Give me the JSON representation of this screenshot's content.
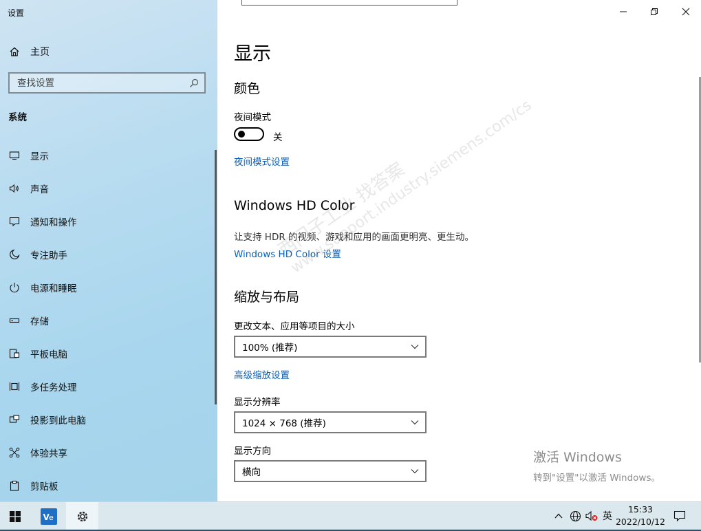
{
  "app": {
    "title": "设置"
  },
  "sidebar": {
    "home_label": "主页",
    "search_placeholder": "查找设置",
    "section_label": "系统",
    "items": [
      {
        "label": "显示",
        "icon": "monitor-icon"
      },
      {
        "label": "声音",
        "icon": "speaker-icon"
      },
      {
        "label": "通知和操作",
        "icon": "notification-icon"
      },
      {
        "label": "专注助手",
        "icon": "moon-icon"
      },
      {
        "label": "电源和睡眠",
        "icon": "power-icon"
      },
      {
        "label": "存储",
        "icon": "storage-icon"
      },
      {
        "label": "平板电脑",
        "icon": "tablet-icon"
      },
      {
        "label": "多任务处理",
        "icon": "multitask-icon"
      },
      {
        "label": "投影到此电脑",
        "icon": "project-icon"
      },
      {
        "label": "体验共享",
        "icon": "share-icon"
      },
      {
        "label": "剪贴板",
        "icon": "clipboard-icon"
      }
    ]
  },
  "main": {
    "title": "显示",
    "color_section": {
      "heading": "颜色",
      "night_mode_label": "夜间模式",
      "night_mode_state": "关",
      "night_mode_on": false,
      "night_mode_link": "夜间模式设置"
    },
    "hdr_section": {
      "heading": "Windows HD Color",
      "description": "让支持 HDR 的视频、游戏和应用的画面更明亮、更生动。",
      "link": "Windows HD Color 设置"
    },
    "scale_section": {
      "heading": "缩放与布局",
      "scale_label": "更改文本、应用等项目的大小",
      "scale_value": "100% (推荐)",
      "advanced_link": "高级缩放设置",
      "resolution_label": "显示分辨率",
      "resolution_value": "1024 × 768 (推荐)",
      "orientation_label": "显示方向",
      "orientation_value": "横向"
    },
    "watermark": {
      "line1": "西门子工业 找答案",
      "line2": "www.support.industry.siemens.com/cs"
    },
    "activation": {
      "title": "激活 Windows",
      "subtitle": "转到\"设置\"以激活 Windows。"
    }
  },
  "taskbar": {
    "input_method": "英",
    "time": "15:33",
    "date": "2022/10/12"
  },
  "colors": {
    "link": "#0a5fb4",
    "sidebar_bg": "#a8d6ee",
    "taskbar_bg": "#dbe8ee",
    "taskbar_app_icon": "#1f6fc5"
  }
}
